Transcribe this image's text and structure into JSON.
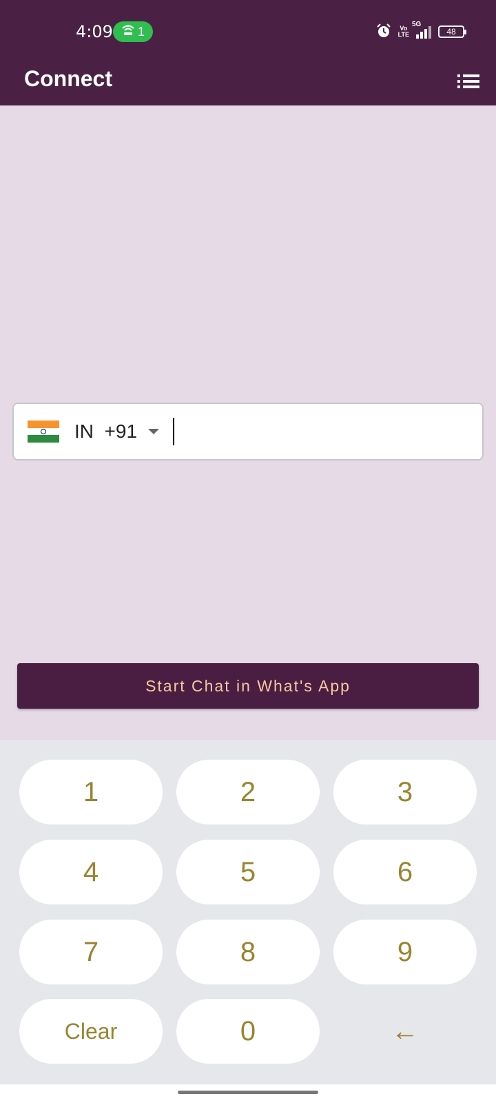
{
  "status_bar": {
    "time": "4:09",
    "hotspot_count": "1",
    "volte": "Vo\nLTE",
    "network": "5G",
    "battery": "48",
    "icons": [
      "hotspot-icon",
      "alarm-icon",
      "volte-icon",
      "signal-icon",
      "battery-icon"
    ]
  },
  "app_bar": {
    "title": "Connect",
    "menu_icon": "list-menu-icon"
  },
  "phone_entry": {
    "country_code_label": "IN  +91",
    "flag": "india-flag-icon",
    "value": "",
    "placeholder": ""
  },
  "start_button": {
    "label": "Start Chat in What's App"
  },
  "keypad": {
    "keys": [
      "1",
      "2",
      "3",
      "4",
      "5",
      "6",
      "7",
      "8",
      "9",
      "Clear",
      "0",
      "←"
    ]
  },
  "colors": {
    "primary": "#4a2145",
    "background": "#e6dae7",
    "accent_text": "#f9c99e",
    "key_text": "#9a8430",
    "keypad_bg": "#e6e7ea",
    "status_pill": "#2fbe4f"
  }
}
